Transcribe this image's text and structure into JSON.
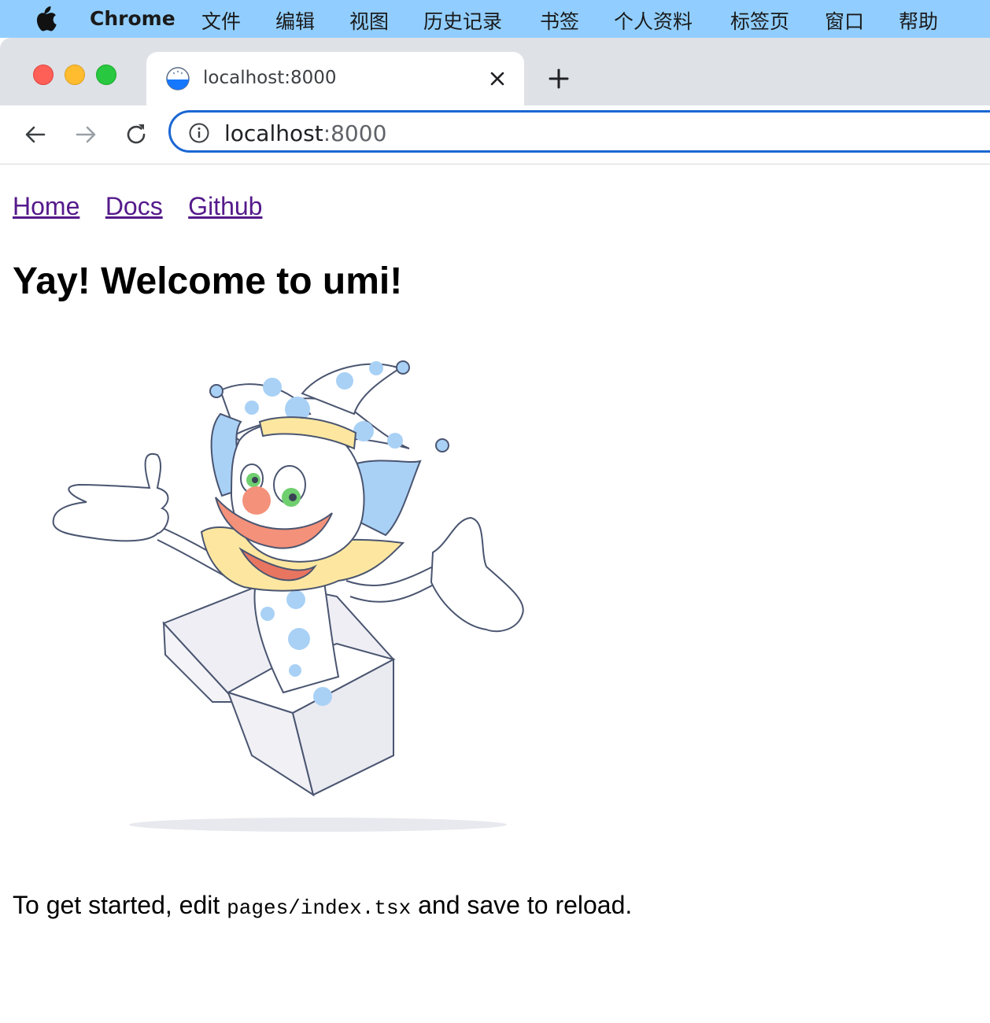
{
  "menubar": {
    "app_name": "Chrome",
    "items": [
      "文件",
      "编辑",
      "视图",
      "历史记录",
      "书签",
      "个人资料",
      "标签页",
      "窗口",
      "帮助"
    ]
  },
  "tab": {
    "title": "localhost:8000",
    "favicon": "umi-rice-bowl-icon"
  },
  "omnibox": {
    "host": "localhost",
    "port": ":8000"
  },
  "page": {
    "nav": [
      "Home",
      "Docs",
      "Github"
    ],
    "title": "Yay! Welcome to umi!",
    "intro_before": "To get started, edit",
    "intro_code": "pages/index.tsx",
    "intro_after": "and save to reload.",
    "illustration": "jester-in-box-illustration"
  },
  "colors": {
    "menubar_bg": "#91ceff",
    "omnibox_border": "#1b67d3",
    "link_visited": "#551a8b"
  }
}
